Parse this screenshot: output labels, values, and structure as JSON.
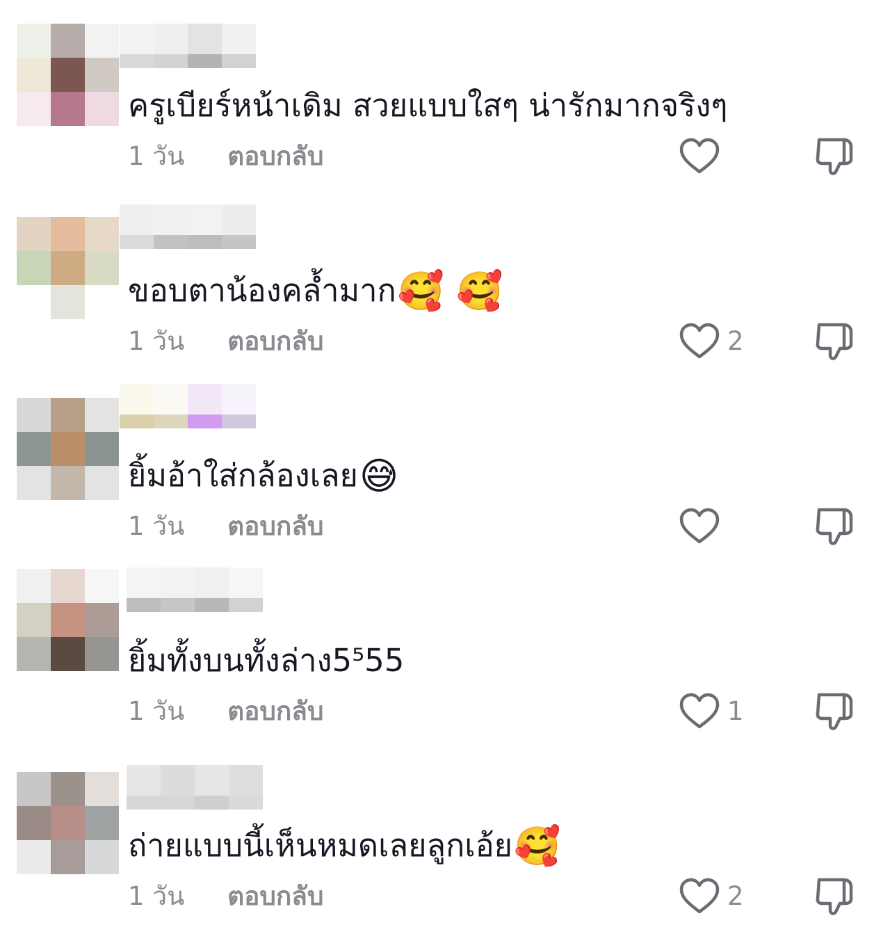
{
  "comments": [
    {
      "text": "ครูเบียร์หน้าเดิม สวยแบบใสๆ น่ารักมากจริงๆ",
      "emoji": "",
      "time": "1 วัน",
      "reply_label": "ตอบกลับ",
      "likes": "",
      "avatar_colors": [
        "#edefe9",
        "#b6aca9",
        "#f2f2f0",
        "#ede9d6",
        "#7c5651",
        "#d1c9c3",
        "#f6eaee",
        "#b5788e",
        "#efd9e2"
      ],
      "name_colors": [
        "#f2f2f2",
        "#efefef",
        "#e3e3e5",
        "#f1f1f1",
        "#d9d9d9",
        "#d3d3d3",
        "#b4b4b4",
        "#d2d2d2"
      ]
    },
    {
      "text": "ขอบตาน้องคล้ำมาก",
      "emoji": "🥰 🥰",
      "time": "1 วัน",
      "reply_label": "ตอบกลับ",
      "likes": "2",
      "avatar_colors": [
        "#e3d3c3",
        "#e5bc9d",
        "#e7d9c8",
        "#c6d6b7",
        "#ceab82",
        "#d8dac4",
        "#ffffff",
        "#e3e4dc",
        "#ffffff"
      ],
      "name_colors": [
        "#efefef",
        "#f1f1f1",
        "#f2f2f2",
        "#ededed",
        "#dbdbdb",
        "#c2c2c2",
        "#bdbdbd",
        "#c5c5c5"
      ]
    },
    {
      "text": "ยิ้มอ้าใส่กล้องเลย",
      "emoji": "😅",
      "time": "1 วัน",
      "reply_label": "ตอบกลับ",
      "likes": "",
      "avatar_colors": [
        "#d6d9d7",
        "#b89f89",
        "#e3e3e3",
        "#8c9793",
        "#ba906b",
        "#8a9592",
        "#e3e3e3",
        "#c2b7aa",
        "#e3e3e3"
      ],
      "name_colors": [
        "#fbf8ee",
        "#fbf9f3",
        "#f3e8f8",
        "#f6f3fb",
        "#d9d0a9",
        "#ddd5bc",
        "#d29bef",
        "#d3c7dd"
      ]
    },
    {
      "text": "ยิ้มทั้งบนทั้งล่าง5⁵55",
      "emoji": "",
      "time": "1 วัน",
      "reply_label": "ตอบกลับ",
      "likes": "1",
      "avatar_colors": [
        "#f0f0f0",
        "#e6d7d0",
        "#f6f6f6",
        "#d3d0c4",
        "#c69282",
        "#ab9c96",
        "#b5b6b1",
        "#5b4a42",
        "#969591"
      ],
      "name_colors": [
        "#f4f4f4",
        "#f2f2f2",
        "#f0f0f0",
        "#f6f6f6",
        "#bdbdbd",
        "#c6c6c6",
        "#b8b8b8",
        "#d2d2d2"
      ]
    },
    {
      "text": "ถ่ายแบบนี้เห็นหมดเลยลูกเอ้ย",
      "emoji": "🥰",
      "time": "1 วัน",
      "reply_label": "ตอบกลับ",
      "likes": "2",
      "avatar_colors": [
        "#c9c6c6",
        "#9b928c",
        "#e3ded9",
        "#9a8b86",
        "#b78f88",
        "#a0a3a3",
        "#ebebeb",
        "#a79c99",
        "#d6d8d9"
      ],
      "name_colors": [
        "#e7e7e7",
        "#dcdcdc",
        "#e6e6e6",
        "#dedede",
        "#d7d7d7",
        "#d7d7d7",
        "#cfcfcf",
        "#dadada"
      ]
    }
  ]
}
